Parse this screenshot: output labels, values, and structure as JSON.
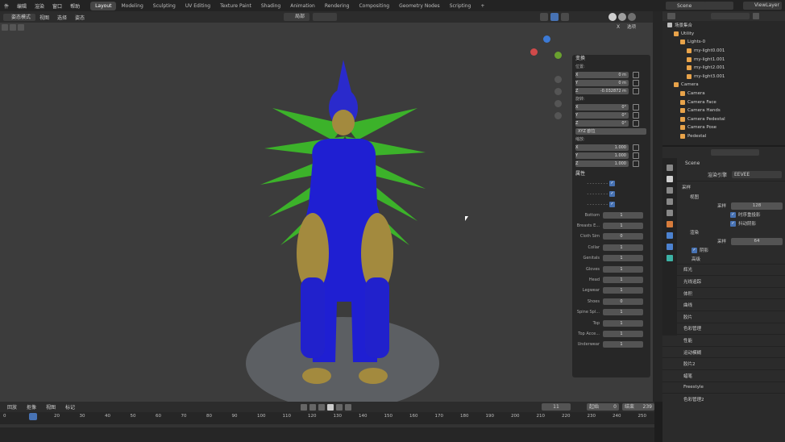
{
  "topbar": {
    "menus": [
      "件",
      "编辑",
      "渲染",
      "窗口",
      "帮助"
    ],
    "workspaces": [
      "Layout",
      "Modeling",
      "Sculpting",
      "UV Editing",
      "Texture Paint",
      "Shading",
      "Animation",
      "Rendering",
      "Compositing",
      "Geometry Nodes",
      "Scripting"
    ],
    "active_workspace": "Layout",
    "add_tab": "+",
    "scene_label": "Scene",
    "view_layer": "ViewLayer"
  },
  "viewport_header": {
    "mode": "姿态模式",
    "menus": [
      "视图",
      "选择",
      "姿态"
    ],
    "transform_orientation": "局部",
    "options": "选项",
    "close": "X"
  },
  "npanel": {
    "transform_title": "变换",
    "location_label": "位置:",
    "location": [
      {
        "axis": "X",
        "value": "0 m"
      },
      {
        "axis": "Y",
        "value": "0 m"
      },
      {
        "axis": "Z",
        "value": "-0.032872 m"
      }
    ],
    "rotation_label": "旋转:",
    "rotation": [
      {
        "axis": "X",
        "value": "0°"
      },
      {
        "axis": "Y",
        "value": "0°"
      },
      {
        "axis": "Z",
        "value": "0°"
      }
    ],
    "rotation_mode": "XYZ 欧拉",
    "scale_label": "缩放:",
    "scale": [
      {
        "axis": "X",
        "value": "1.000"
      },
      {
        "axis": "Y",
        "value": "1.000"
      },
      {
        "axis": "Z",
        "value": "1.000"
      }
    ],
    "props_title": "属性",
    "dashed": [
      "- - - - - - - -",
      "- - - - - - - -",
      "- - - - - - - -"
    ],
    "props": [
      {
        "label": "Bottom",
        "value": "1"
      },
      {
        "label": "Breasts E...",
        "value": "1"
      },
      {
        "label": "Cloth Sim",
        "value": "0"
      },
      {
        "label": "Collar",
        "value": "1"
      },
      {
        "label": "Genitals",
        "value": "1"
      },
      {
        "label": "Gloves",
        "value": "1"
      },
      {
        "label": "Head",
        "value": "1"
      },
      {
        "label": "Legwear",
        "value": "1"
      },
      {
        "label": "Shoes",
        "value": "0"
      },
      {
        "label": "Spine Spl...",
        "value": "1"
      },
      {
        "label": "Top",
        "value": "1"
      },
      {
        "label": "Top Acce...",
        "value": "1"
      },
      {
        "label": "Underwear",
        "value": "1"
      }
    ]
  },
  "outliner": {
    "search_placeholder": "",
    "rows": [
      {
        "label": "场景集合",
        "indent": 0,
        "color": "#bdbdbd"
      },
      {
        "label": "Utility",
        "indent": 1,
        "color": "#e8a34a"
      },
      {
        "label": "Lights-0",
        "indent": 2,
        "color": "#e8a34a"
      },
      {
        "label": "my-light0.001",
        "indent": 3,
        "color": "#e8a34a"
      },
      {
        "label": "my-light1.001",
        "indent": 3,
        "color": "#e8a34a"
      },
      {
        "label": "my-light2.001",
        "indent": 3,
        "color": "#e8a34a"
      },
      {
        "label": "my-light3.001",
        "indent": 3,
        "color": "#e8a34a"
      },
      {
        "label": "Camera",
        "indent": 1,
        "color": "#e8a34a"
      },
      {
        "label": "Camera",
        "indent": 2,
        "color": "#e8a34a"
      },
      {
        "label": "Camera Face",
        "indent": 2,
        "color": "#e8a34a"
      },
      {
        "label": "Camera Hands",
        "indent": 2,
        "color": "#e8a34a"
      },
      {
        "label": "Camera Pedestal",
        "indent": 2,
        "color": "#e8a34a"
      },
      {
        "label": "Camera Pose",
        "indent": 2,
        "color": "#e8a34a"
      },
      {
        "label": "Pedestal",
        "indent": 2,
        "color": "#e8a34a"
      }
    ]
  },
  "properties": {
    "scene": "Scene",
    "render_engine_label": "渲染引擎",
    "render_engine": "EEVEE",
    "sampling": "采样",
    "viewport": "视图",
    "samples_label": "采样",
    "viewport_samples": "128",
    "temporal_reprojection": "时序重投影",
    "jitter_shadows": "抖动阴影",
    "render": "渲染",
    "render_samples": "64",
    "shadows": "阴影",
    "advanced": "高级",
    "sections": [
      "辉光",
      "光线追踪",
      "体积",
      "曲线",
      "胶片",
      "色彩管理",
      "性能",
      "运动模糊",
      "胶片2",
      "蜡笔",
      "Freestyle",
      "色彩管理2"
    ]
  },
  "timeline": {
    "menus": [
      "回放",
      "抠像",
      "视图",
      "标记"
    ],
    "current_frame": "11",
    "start_label": "起始",
    "start": "0",
    "end_label": "结束",
    "end": "239",
    "ticks": [
      "0",
      "11",
      "20",
      "30",
      "40",
      "50",
      "60",
      "70",
      "80",
      "90",
      "100",
      "110",
      "120",
      "130",
      "140",
      "150",
      "160",
      "170",
      "180",
      "190",
      "200",
      "210",
      "220",
      "230",
      "240",
      "250"
    ]
  }
}
